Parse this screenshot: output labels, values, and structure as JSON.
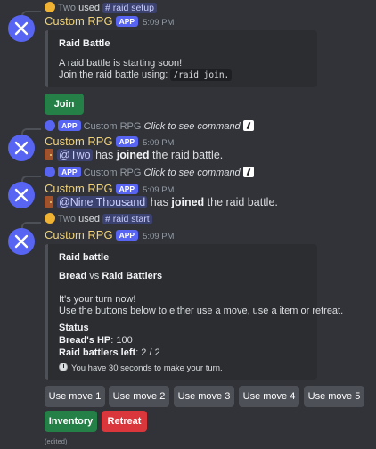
{
  "messages": {
    "m1_reply": {
      "user": "Two",
      "used": "used",
      "command": "raid setup"
    },
    "m1": {
      "username": "Custom RPG",
      "app": "APP",
      "time": "5:09 PM",
      "embed_title": "Raid Battle",
      "embed_line1": "A raid battle is starting soon!",
      "embed_line2": "Join the raid battle using: ",
      "embed_code": "/raid join.",
      "button": "Join"
    },
    "m2_reply": {
      "app": "APP",
      "user": "Custom RPG",
      "text": "Click to see command"
    },
    "m2": {
      "username": "Custom RPG",
      "app": "APP",
      "time": "5:09 PM",
      "mention": "@Two",
      "pre": " has ",
      "bold": "joined",
      "post": " the raid battle."
    },
    "m3_reply": {
      "app": "APP",
      "user": "Custom RPG",
      "text": "Click to see command"
    },
    "m3": {
      "username": "Custom RPG",
      "app": "APP",
      "time": "5:09 PM",
      "mention": "@Nine Thousand",
      "pre": " has ",
      "bold": "joined",
      "post": " the raid battle."
    },
    "m4_reply": {
      "user": "Two",
      "used": "used",
      "command": "raid start"
    },
    "m4": {
      "username": "Custom RPG",
      "app": "APP",
      "time": "5:09 PM",
      "embed_title": "Raid battle",
      "vs_left": "Bread",
      "vs_mid": " vs ",
      "vs_right": "Raid Battlers",
      "turn_line1": "It's your turn now!",
      "turn_line2": "Use the buttons below to either use a move, use a item or retreat.",
      "status_label": "Status",
      "hp_label": "Bread's HP",
      "hp_value": ": 100",
      "raiders_label": "Raid battlers left",
      "raiders_value": ": 2 / 2",
      "timer": "You have 30 seconds to make your turn.",
      "moves": [
        "Use move 1",
        "Use move 2",
        "Use move 3",
        "Use move 4",
        "Use move 5"
      ],
      "inventory": "Inventory",
      "retreat": "Retreat",
      "edited": "(edited)"
    }
  },
  "colors": {
    "accent": "#5865f2",
    "username": "#f0d27a",
    "success": "#248046",
    "danger": "#da373c"
  }
}
